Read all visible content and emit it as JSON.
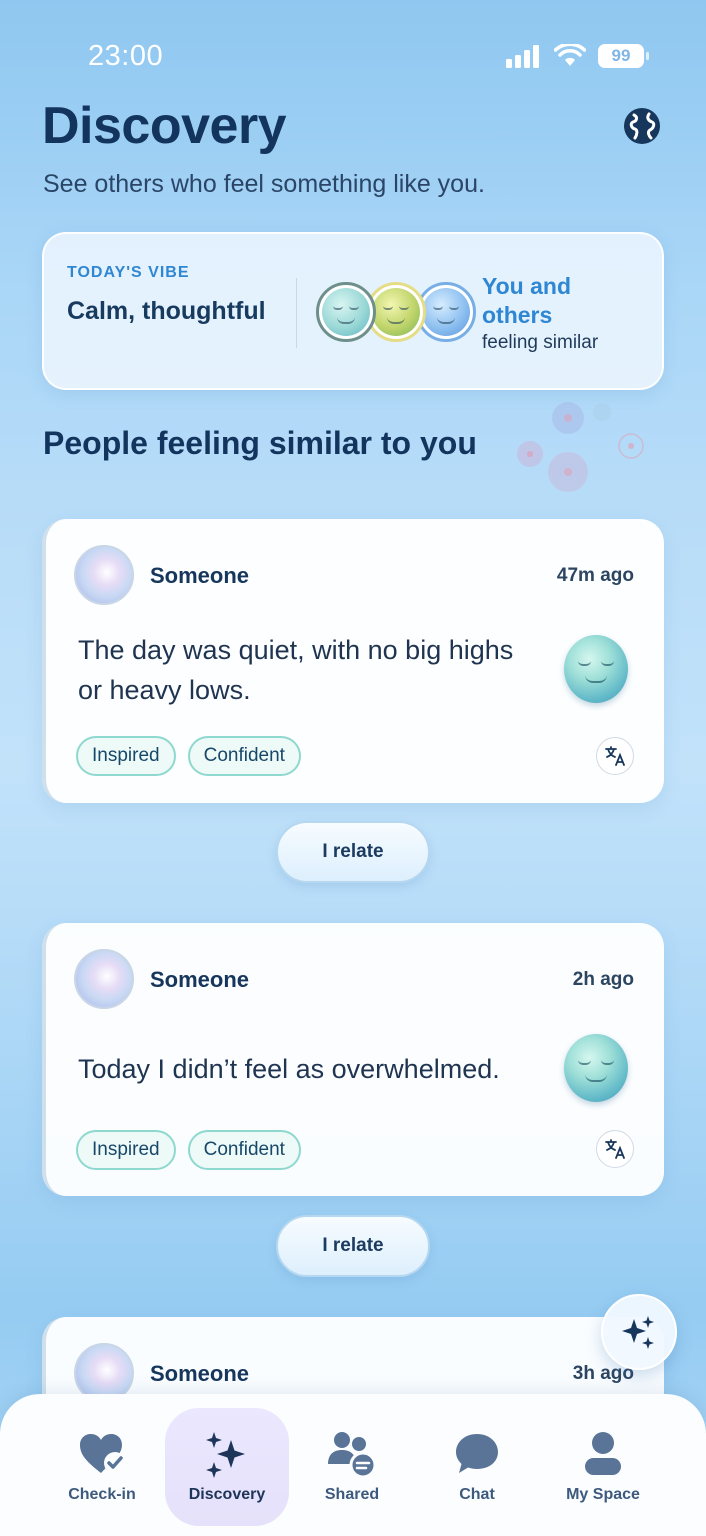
{
  "status_bar": {
    "time": "23:00",
    "battery": "99"
  },
  "header": {
    "title": "Discovery",
    "subtitle": "See others who feel something like you."
  },
  "vibe_card": {
    "label": "TODAY'S VIBE",
    "value": "Calm, thoughtful",
    "others_title": "You and others",
    "others_sub": "feeling similar"
  },
  "section_title": "People feeling similar to you",
  "posts": [
    {
      "author": "Someone",
      "time": "47m ago",
      "text": "The day was quiet, with no big highs or heavy lows.",
      "tags": [
        "Inspired",
        "Confident"
      ],
      "relate_label": "I relate"
    },
    {
      "author": "Someone",
      "time": "2h ago",
      "text": "Today I didn’t feel as overwhelmed.",
      "tags": [
        "Inspired",
        "Confident"
      ],
      "relate_label": "I relate"
    },
    {
      "author": "Someone",
      "time": "3h ago"
    }
  ],
  "nav": [
    {
      "label": "Check-in",
      "icon": "heart-check-icon"
    },
    {
      "label": "Discovery",
      "icon": "sparkles-icon"
    },
    {
      "label": "Shared",
      "icon": "people-chat-icon"
    },
    {
      "label": "Chat",
      "icon": "chat-bubble-icon"
    },
    {
      "label": "My Space",
      "icon": "person-icon"
    }
  ],
  "colors": {
    "accent": "#2f86d2",
    "title": "#13345d",
    "tag_border": "#8fd8cf"
  }
}
